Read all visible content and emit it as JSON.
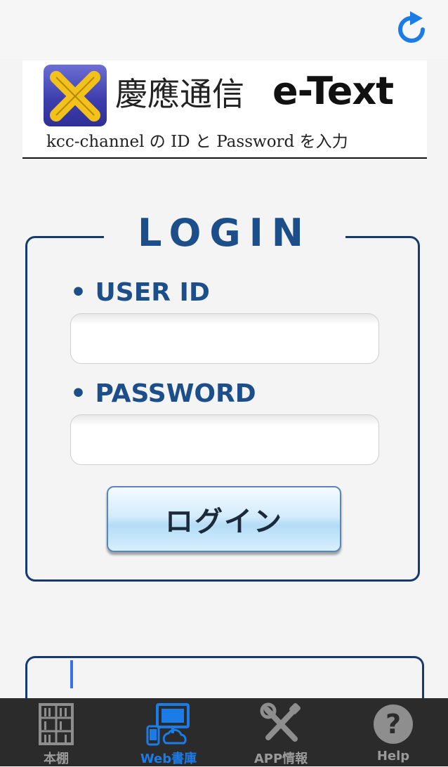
{
  "banner": {
    "title": "慶應通信",
    "brand": "e-Text",
    "subtitle": "kcc-channel の ID と Password を入力"
  },
  "login": {
    "heading": "LOGIN",
    "user_id_label": "• USER ID",
    "user_id_value": "",
    "password_label": "• PASSWORD",
    "password_value": "",
    "submit_label": "ログイン"
  },
  "tabs": [
    {
      "label": "本棚",
      "icon": "bookshelf-icon",
      "active": false
    },
    {
      "label": "Web書庫",
      "icon": "web-library-icon",
      "active": true
    },
    {
      "label": "APP情報",
      "icon": "tools-icon",
      "active": false
    },
    {
      "label": "Help",
      "icon": "help-icon",
      "active": false
    }
  ],
  "colors": {
    "accent": "#1c4e8a",
    "active_tab": "#1b7ce8",
    "tab_bar": "#2b2b2b",
    "refresh": "#1b7ce8"
  }
}
